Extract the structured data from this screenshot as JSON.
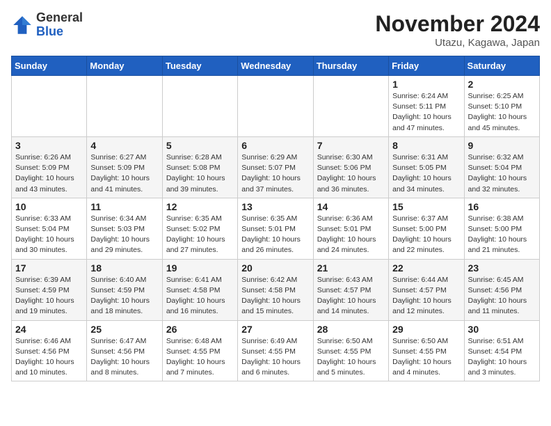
{
  "header": {
    "logo_general": "General",
    "logo_blue": "Blue",
    "month_title": "November 2024",
    "location": "Utazu, Kagawa, Japan"
  },
  "weekdays": [
    "Sunday",
    "Monday",
    "Tuesday",
    "Wednesday",
    "Thursday",
    "Friday",
    "Saturday"
  ],
  "weeks": [
    [
      {
        "day": "",
        "info": ""
      },
      {
        "day": "",
        "info": ""
      },
      {
        "day": "",
        "info": ""
      },
      {
        "day": "",
        "info": ""
      },
      {
        "day": "",
        "info": ""
      },
      {
        "day": "1",
        "info": "Sunrise: 6:24 AM\nSunset: 5:11 PM\nDaylight: 10 hours\nand 47 minutes."
      },
      {
        "day": "2",
        "info": "Sunrise: 6:25 AM\nSunset: 5:10 PM\nDaylight: 10 hours\nand 45 minutes."
      }
    ],
    [
      {
        "day": "3",
        "info": "Sunrise: 6:26 AM\nSunset: 5:09 PM\nDaylight: 10 hours\nand 43 minutes."
      },
      {
        "day": "4",
        "info": "Sunrise: 6:27 AM\nSunset: 5:09 PM\nDaylight: 10 hours\nand 41 minutes."
      },
      {
        "day": "5",
        "info": "Sunrise: 6:28 AM\nSunset: 5:08 PM\nDaylight: 10 hours\nand 39 minutes."
      },
      {
        "day": "6",
        "info": "Sunrise: 6:29 AM\nSunset: 5:07 PM\nDaylight: 10 hours\nand 37 minutes."
      },
      {
        "day": "7",
        "info": "Sunrise: 6:30 AM\nSunset: 5:06 PM\nDaylight: 10 hours\nand 36 minutes."
      },
      {
        "day": "8",
        "info": "Sunrise: 6:31 AM\nSunset: 5:05 PM\nDaylight: 10 hours\nand 34 minutes."
      },
      {
        "day": "9",
        "info": "Sunrise: 6:32 AM\nSunset: 5:04 PM\nDaylight: 10 hours\nand 32 minutes."
      }
    ],
    [
      {
        "day": "10",
        "info": "Sunrise: 6:33 AM\nSunset: 5:04 PM\nDaylight: 10 hours\nand 30 minutes."
      },
      {
        "day": "11",
        "info": "Sunrise: 6:34 AM\nSunset: 5:03 PM\nDaylight: 10 hours\nand 29 minutes."
      },
      {
        "day": "12",
        "info": "Sunrise: 6:35 AM\nSunset: 5:02 PM\nDaylight: 10 hours\nand 27 minutes."
      },
      {
        "day": "13",
        "info": "Sunrise: 6:35 AM\nSunset: 5:01 PM\nDaylight: 10 hours\nand 26 minutes."
      },
      {
        "day": "14",
        "info": "Sunrise: 6:36 AM\nSunset: 5:01 PM\nDaylight: 10 hours\nand 24 minutes."
      },
      {
        "day": "15",
        "info": "Sunrise: 6:37 AM\nSunset: 5:00 PM\nDaylight: 10 hours\nand 22 minutes."
      },
      {
        "day": "16",
        "info": "Sunrise: 6:38 AM\nSunset: 5:00 PM\nDaylight: 10 hours\nand 21 minutes."
      }
    ],
    [
      {
        "day": "17",
        "info": "Sunrise: 6:39 AM\nSunset: 4:59 PM\nDaylight: 10 hours\nand 19 minutes."
      },
      {
        "day": "18",
        "info": "Sunrise: 6:40 AM\nSunset: 4:59 PM\nDaylight: 10 hours\nand 18 minutes."
      },
      {
        "day": "19",
        "info": "Sunrise: 6:41 AM\nSunset: 4:58 PM\nDaylight: 10 hours\nand 16 minutes."
      },
      {
        "day": "20",
        "info": "Sunrise: 6:42 AM\nSunset: 4:58 PM\nDaylight: 10 hours\nand 15 minutes."
      },
      {
        "day": "21",
        "info": "Sunrise: 6:43 AM\nSunset: 4:57 PM\nDaylight: 10 hours\nand 14 minutes."
      },
      {
        "day": "22",
        "info": "Sunrise: 6:44 AM\nSunset: 4:57 PM\nDaylight: 10 hours\nand 12 minutes."
      },
      {
        "day": "23",
        "info": "Sunrise: 6:45 AM\nSunset: 4:56 PM\nDaylight: 10 hours\nand 11 minutes."
      }
    ],
    [
      {
        "day": "24",
        "info": "Sunrise: 6:46 AM\nSunset: 4:56 PM\nDaylight: 10 hours\nand 10 minutes."
      },
      {
        "day": "25",
        "info": "Sunrise: 6:47 AM\nSunset: 4:56 PM\nDaylight: 10 hours\nand 8 minutes."
      },
      {
        "day": "26",
        "info": "Sunrise: 6:48 AM\nSunset: 4:55 PM\nDaylight: 10 hours\nand 7 minutes."
      },
      {
        "day": "27",
        "info": "Sunrise: 6:49 AM\nSunset: 4:55 PM\nDaylight: 10 hours\nand 6 minutes."
      },
      {
        "day": "28",
        "info": "Sunrise: 6:50 AM\nSunset: 4:55 PM\nDaylight: 10 hours\nand 5 minutes."
      },
      {
        "day": "29",
        "info": "Sunrise: 6:50 AM\nSunset: 4:55 PM\nDaylight: 10 hours\nand 4 minutes."
      },
      {
        "day": "30",
        "info": "Sunrise: 6:51 AM\nSunset: 4:54 PM\nDaylight: 10 hours\nand 3 minutes."
      }
    ]
  ]
}
